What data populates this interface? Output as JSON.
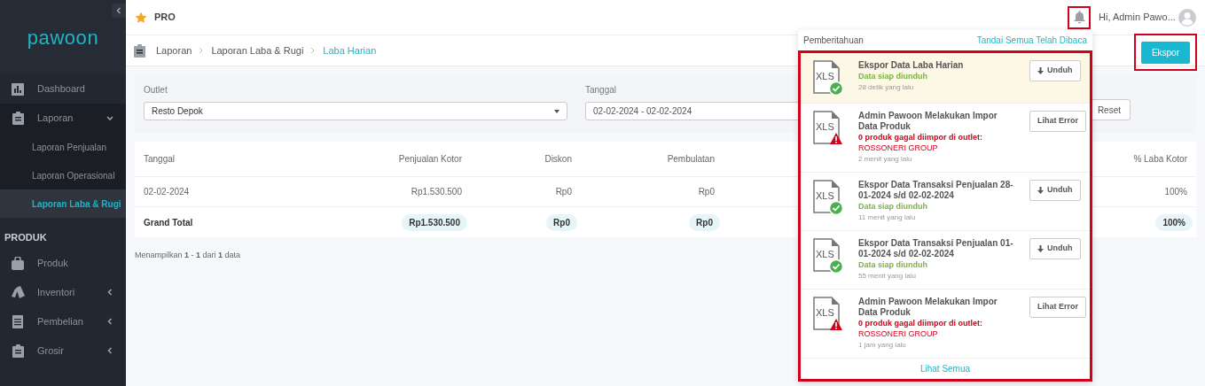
{
  "sidebar": {
    "logo": "pawoon",
    "items": [
      {
        "label": "Dashboard",
        "selected": false,
        "expanded": false,
        "has_caret": false
      },
      {
        "label": "Laporan",
        "selected": false,
        "expanded": true,
        "has_caret": true,
        "children": [
          {
            "label": "Laporan Penjualan",
            "selected": false
          },
          {
            "label": "Laporan Operasional",
            "selected": false
          },
          {
            "label": "Laporan Laba & Rugi",
            "selected": true
          }
        ]
      }
    ],
    "section": "PRODUK",
    "section_items": [
      {
        "label": "Produk",
        "selected": false,
        "expanded": false,
        "has_caret": false
      },
      {
        "label": "Inventori",
        "selected": false,
        "expanded": false,
        "has_caret": true
      },
      {
        "label": "Pembelian",
        "selected": false,
        "expanded": false,
        "has_caret": true
      },
      {
        "label": "Grosir",
        "selected": false,
        "expanded": false,
        "has_caret": true
      }
    ]
  },
  "header": {
    "plan": "PRO",
    "greeting": "Hi, Admin Pawo..."
  },
  "breadcrumb": [
    {
      "label": "Laporan",
      "selected": false
    },
    {
      "label": "Laporan Laba & Rugi",
      "selected": false
    },
    {
      "label": "Laba Harian",
      "selected": true
    }
  ],
  "export_button": "Ekspor",
  "filters": {
    "outlet_label": "Outlet",
    "outlet_value": "Resto Depok",
    "date_label": "Tanggal",
    "date_value": "02-02-2024 - 02-02-2024",
    "reset_button": "Reset"
  },
  "table": {
    "columns": [
      "Tanggal",
      "Penjualan Kotor",
      "Diskon",
      "Pembulatan",
      "% Laba Kotor"
    ],
    "rows": [
      [
        "02-02-2024",
        "Rp1.530.500",
        "Rp0",
        "Rp0",
        "100%"
      ]
    ],
    "total": [
      "Grand Total",
      "Rp1.530.500",
      "Rp0",
      "Rp0",
      "100%"
    ]
  },
  "pagination": "Menampilkan **1** - **1** dari **1** data",
  "notifications": {
    "title": "Pemberitahuan",
    "mark_all": "Tandai Semua Telah Dibaca",
    "footer": "Lihat Semua",
    "items": [
      {
        "kind": "export",
        "unread": true,
        "file": "XLS",
        "title": "Ekspor Data Laba Harian",
        "status": "Data siap diunduh",
        "time": "28 detik yang lalu",
        "button": "Unduh"
      },
      {
        "kind": "import",
        "unread": false,
        "file": "XLS",
        "title": "Admin Pawoon Melakukan Impor Data Produk",
        "status": "0 produk gagal diimpor di outlet:",
        "detail": "ROSSONERI GROUP",
        "time": "2 menit yang lalu",
        "button": "Lihat Error"
      },
      {
        "kind": "export",
        "unread": false,
        "file": "XLS",
        "title": "Ekspor Data Transaksi Penjualan 28-01-2024 s/d 02-02-2024",
        "status": "Data siap diunduh",
        "time": "11 menit yang lalu",
        "button": "Unduh"
      },
      {
        "kind": "export",
        "unread": false,
        "file": "XLS",
        "title": "Ekspor Data Transaksi Penjualan 01-01-2024 s/d 02-02-2024",
        "status": "Data siap diunduh",
        "time": "55 menit yang lalu",
        "button": "Unduh"
      },
      {
        "kind": "import",
        "unread": false,
        "file": "XLS",
        "title": "Admin Pawoon Melakukan Impor Data Produk",
        "status": "0 produk gagal diimpor di outlet:",
        "detail": "ROSSONERI GROUP",
        "time": "1 jam yang lalu",
        "button": "Lihat Error"
      }
    ]
  }
}
